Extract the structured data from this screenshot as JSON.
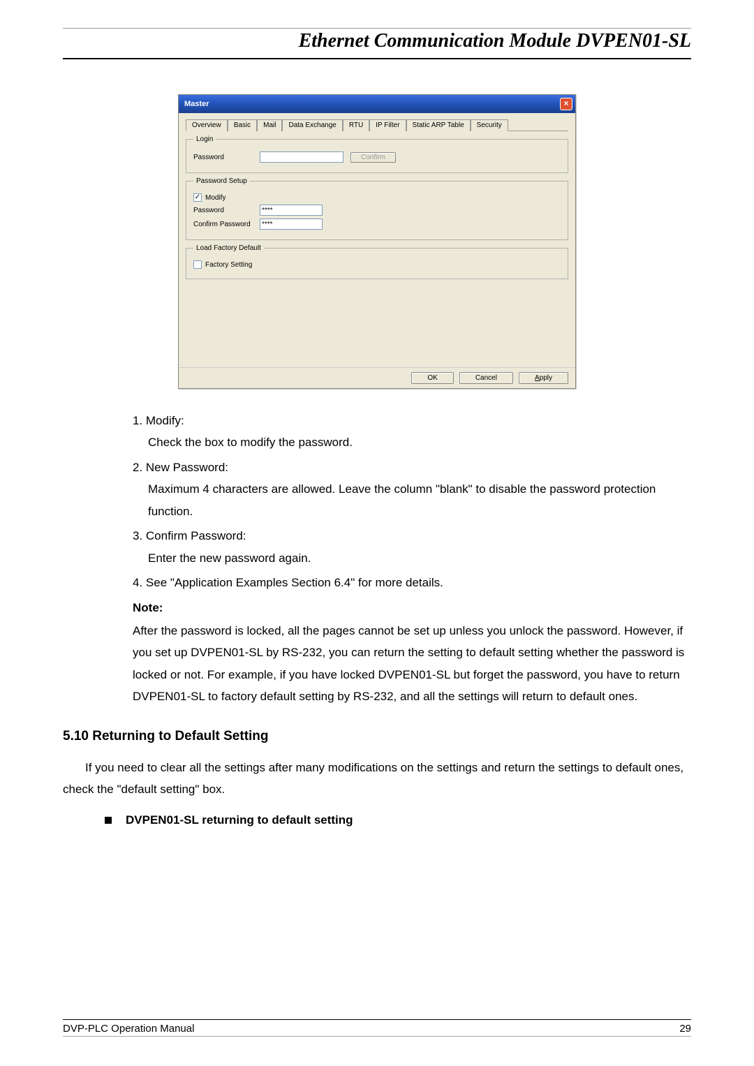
{
  "header": {
    "title": "Ethernet Communication Module DVPEN01-SL"
  },
  "dialog": {
    "title": "Master",
    "close_glyph": "×",
    "tabs": [
      "Overview",
      "Basic",
      "Mail",
      "Data Exchange",
      "RTU",
      "IP Filter",
      "Static ARP Table",
      "Security"
    ],
    "active_tab_index": 7,
    "login": {
      "legend": "Login",
      "password_label": "Password",
      "password_value": "",
      "confirm_button": "Confirm"
    },
    "password_setup": {
      "legend": "Password Setup",
      "modify_label": "Modify",
      "modify_checked": true,
      "password_label": "Password",
      "password_value": "****",
      "confirm_password_label": "Confirm Password",
      "confirm_password_value": "****"
    },
    "factory": {
      "legend": "Load Factory Default",
      "factory_label": "Factory Setting",
      "factory_checked": false
    },
    "buttons": {
      "ok": "OK",
      "cancel": "Cancel",
      "apply_prefix": "A",
      "apply_rest": "pply"
    }
  },
  "list": {
    "item1_num": "1. Modify:",
    "item1_desc": "Check the box to modify the password.",
    "item2_num": "2. New Password:",
    "item2_desc": "Maximum 4 characters are allowed. Leave the column \"blank\" to disable the password protection function.",
    "item3_num": "3. Confirm Password:",
    "item3_desc": "Enter the new password again.",
    "item4_num": "4. See \"Application Examples Section 6.4\" for more details.",
    "note_label": "Note:",
    "note_body": "After the password is locked, all the pages cannot be set up unless you unlock the password. However, if you set up DVPEN01-SL by RS-232, you can return the setting to default setting whether the password is locked or not. For example, if you have locked DVPEN01-SL but forget the password, you have to return DVPEN01-SL to factory default setting by RS-232, and all the settings will return to default ones."
  },
  "section": {
    "heading": "5.10  Returning to Default Setting",
    "para": "If you need to clear all the settings after many modifications on the settings and return the settings to default ones, check the \"default setting\" box.",
    "bullet": "DVPEN01-SL returning to default setting"
  },
  "footer": {
    "left": "DVP-PLC Operation Manual",
    "right": "29"
  }
}
